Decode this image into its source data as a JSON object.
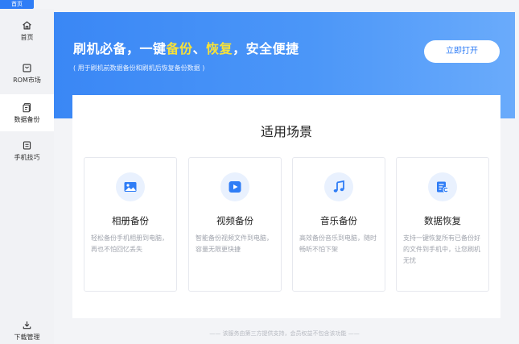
{
  "top_tab": {
    "label": "首页"
  },
  "sidebar": {
    "items": [
      {
        "label": "首页",
        "icon": "home-icon"
      },
      {
        "label": "ROM市场",
        "icon": "rom-market-icon"
      },
      {
        "label": "数据备份",
        "icon": "backup-icon"
      },
      {
        "label": "手机技巧",
        "icon": "tips-icon"
      },
      {
        "label": "下载管理",
        "icon": "download-icon"
      }
    ]
  },
  "hero": {
    "title_part1": "刷机必备，一键",
    "title_hl1": "备份",
    "title_sep": "、",
    "title_hl2": "恢复",
    "title_part2": "，安全便捷",
    "subtitle": "( 用于刷机前数据备份和刷机后恢复备份数据 )",
    "button_label": "立即打开"
  },
  "scenarios": {
    "title": "适用场景",
    "cards": [
      {
        "title": "相册备份",
        "desc": "轻松备份手机相册到电脑，再也不怕回忆丢失",
        "icon": "photo-icon"
      },
      {
        "title": "视频备份",
        "desc": "智能备份视频文件到电脑，容量无限更快捷",
        "icon": "video-icon"
      },
      {
        "title": "音乐备份",
        "desc": "高效备份音乐到电脑，随时畅听不怕下架",
        "icon": "music-icon"
      },
      {
        "title": "数据恢复",
        "desc": "支持一键恢复所有已备份好的文件到手机中，让您刷机无忧",
        "icon": "data-restore-icon"
      }
    ]
  },
  "footer": {
    "text": "—— 该服务由第三方提供支持，会员权益不包含该功能 ——"
  },
  "colors": {
    "accent": "#2f7df6",
    "highlight": "#f6e13a"
  }
}
